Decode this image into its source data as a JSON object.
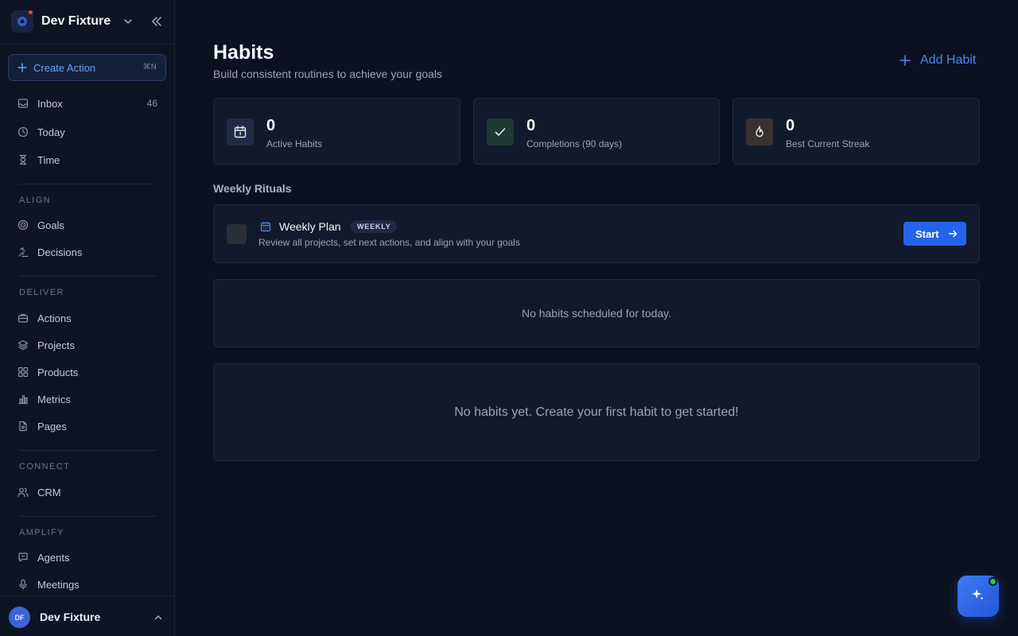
{
  "workspace": {
    "name": "Dev Fixture"
  },
  "create_action": {
    "label": "Create Action",
    "shortcut": "⌘N"
  },
  "nav": {
    "inbox": {
      "label": "Inbox",
      "count": "46"
    },
    "today": {
      "label": "Today"
    },
    "time": {
      "label": "Time"
    },
    "align_label": "ALIGN",
    "goals": {
      "label": "Goals"
    },
    "decisions": {
      "label": "Decisions"
    },
    "deliver_label": "DELIVER",
    "actions": {
      "label": "Actions"
    },
    "projects": {
      "label": "Projects"
    },
    "products": {
      "label": "Products"
    },
    "metrics": {
      "label": "Metrics"
    },
    "pages": {
      "label": "Pages"
    },
    "connect_label": "CONNECT",
    "crm": {
      "label": "CRM"
    },
    "amplify_label": "AMPLIFY",
    "agents": {
      "label": "Agents"
    },
    "meetings": {
      "label": "Meetings"
    }
  },
  "user": {
    "initials": "DF",
    "name": "Dev Fixture"
  },
  "page": {
    "title": "Habits",
    "subtitle": "Build consistent routines to achieve your goals",
    "add_label": "Add Habit"
  },
  "stats": [
    {
      "value": "0",
      "label": "Active Habits",
      "icon": "calendar-icon",
      "color": "#1e2d45"
    },
    {
      "value": "0",
      "label": "Completions (90 days)",
      "icon": "check-icon",
      "color": "#1e3a33"
    },
    {
      "value": "0",
      "label": "Best Current Streak",
      "icon": "flame-icon",
      "color": "#37322f"
    }
  ],
  "rituals": {
    "section_title": "Weekly Rituals",
    "items": [
      {
        "name": "Weekly Plan",
        "badge": "WEEKLY",
        "description": "Review all projects, set next actions, and align with your goals",
        "action_label": "Start"
      }
    ]
  },
  "empty_today": "No habits scheduled for today.",
  "empty_habits": "No habits yet. Create your first habit to get started!",
  "colors": {
    "accent": "#2563eb",
    "link": "#4f86f7",
    "background": "#0b1120",
    "card": "#111a2c"
  }
}
